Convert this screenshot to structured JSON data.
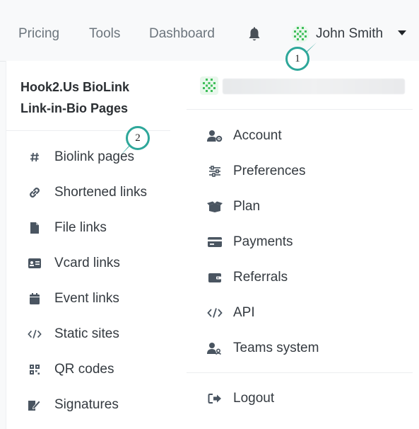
{
  "nav": {
    "links": [
      "Pricing",
      "Tools",
      "Dashboard"
    ],
    "bell_icon": "bell-icon",
    "user_name": "John Smith"
  },
  "brand": {
    "line1": "Hook2.Us BioLink",
    "line2": "Link-in-Bio Pages"
  },
  "left_menu": [
    {
      "label": "Biolink pages",
      "icon": "hash-icon"
    },
    {
      "label": "Shortened links",
      "icon": "link-icon"
    },
    {
      "label": "File links",
      "icon": "file-icon"
    },
    {
      "label": "Vcard links",
      "icon": "vcard-icon"
    },
    {
      "label": "Event links",
      "icon": "calendar-icon"
    },
    {
      "label": "Static sites",
      "icon": "code-icon"
    },
    {
      "label": "QR codes",
      "icon": "qrcode-icon"
    },
    {
      "label": "Signatures",
      "icon": "signature-icon"
    }
  ],
  "right_menu": [
    {
      "label": "Account",
      "icon": "user-cog-icon"
    },
    {
      "label": "Preferences",
      "icon": "sliders-icon"
    },
    {
      "label": "Plan",
      "icon": "box-open-icon"
    },
    {
      "label": "Payments",
      "icon": "credit-card-icon"
    },
    {
      "label": "Referrals",
      "icon": "wallet-icon"
    },
    {
      "label": "API",
      "icon": "code-icon"
    },
    {
      "label": "Teams system",
      "icon": "user-team-icon"
    }
  ],
  "logout": {
    "label": "Logout",
    "icon": "sign-out-icon"
  },
  "callouts": [
    "1",
    "2"
  ],
  "colors": {
    "callout_accent": "#2ea79a",
    "avatar_green": "#3fbf5a"
  }
}
